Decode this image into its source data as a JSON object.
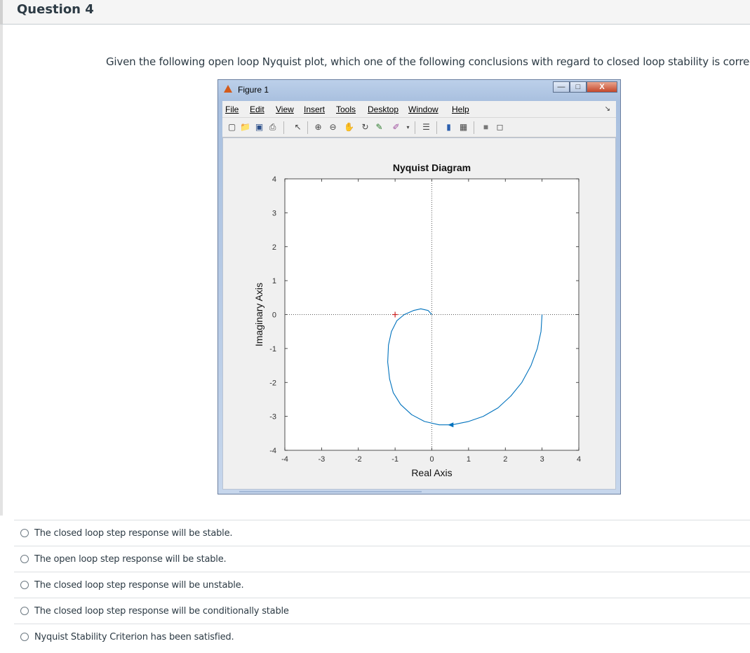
{
  "question": {
    "title": "Question 4",
    "text": "Given the following open loop Nyquist plot, which one of the following conclusions with regard to closed loop stability is correct?"
  },
  "figure_window": {
    "title": "Figure 1",
    "menu": [
      "File",
      "Edit",
      "View",
      "Insert",
      "Tools",
      "Desktop",
      "Window",
      "Help"
    ],
    "toolbar_icons": [
      "new-figure-icon",
      "open-file-icon",
      "save-icon",
      "print-icon",
      "pointer-icon",
      "zoom-in-icon",
      "zoom-out-icon",
      "pan-icon",
      "rotate-icon",
      "data-cursor-icon",
      "brush-icon",
      "link-plot-icon",
      "colorbar-icon",
      "legend-icon",
      "hide-tools-icon",
      "show-tools-icon"
    ],
    "close_glyph": "X"
  },
  "chart_data": {
    "type": "line",
    "title": "Nyquist Diagram",
    "xlabel": "Real Axis",
    "ylabel": "Imaginary Axis",
    "xlim": [
      -4,
      4
    ],
    "ylim": [
      -4,
      4
    ],
    "xticks": [
      -4,
      -3,
      -2,
      -1,
      0,
      1,
      2,
      3,
      4
    ],
    "yticks": [
      -4,
      -3,
      -2,
      -1,
      0,
      1,
      2,
      3,
      4
    ],
    "grid": false,
    "series_color": "#0072bd",
    "critical_point": [
      -1,
      0
    ],
    "critical_point_color": "#cc2222",
    "zero_lines_color": "#5a5a5a",
    "series": [
      {
        "x": [
          3.0,
          2.97,
          2.87,
          2.7,
          2.45,
          2.15,
          1.8,
          1.4,
          1.0,
          0.55,
          0.2,
          -0.2,
          -0.55,
          -0.85,
          -1.05,
          -1.15,
          -1.2,
          -1.18,
          -1.1,
          -0.95,
          -0.75,
          -0.5,
          -0.3,
          -0.1,
          0.0
        ],
        "y": [
          0.0,
          -0.5,
          -1.0,
          -1.5,
          -2.0,
          -2.4,
          -2.75,
          -3.0,
          -3.15,
          -3.25,
          -3.25,
          -3.15,
          -2.95,
          -2.65,
          -2.3,
          -1.9,
          -1.4,
          -0.9,
          -0.5,
          -0.18,
          0.0,
          0.12,
          0.17,
          0.12,
          0.0
        ],
        "arrow_at": [
          0.55,
          -3.25
        ]
      }
    ]
  },
  "options": [
    "The closed loop step response will be stable.",
    "The open loop step response will be stable.",
    "The closed loop step response will be unstable.",
    "The closed loop step response will be conditionally stable",
    "Nyquist Stability Criterion has been satisfied."
  ]
}
